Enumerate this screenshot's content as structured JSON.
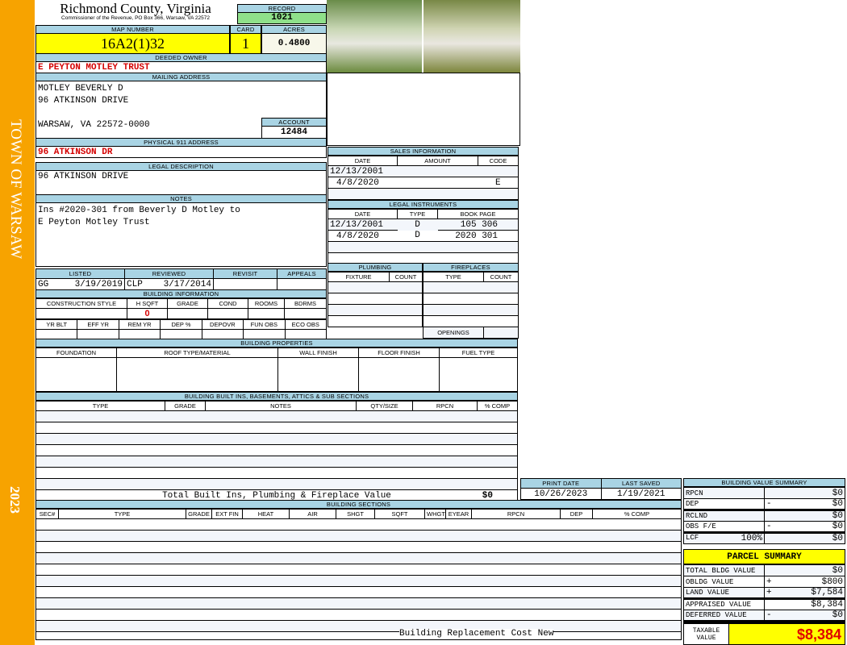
{
  "side": {
    "town": "TOWN OF WARSAW",
    "year": "2023"
  },
  "header": {
    "title": "Richmond County, Virginia",
    "subtitle": "Commissioner of the Revenue, PO Box 366, Warsaw, VA 22572",
    "record_label": "RECORD",
    "record": "1021"
  },
  "map": {
    "map_label": "MAP NUMBER",
    "map_number": "16A2(1)32",
    "card_label": "CARD",
    "card": "1",
    "acres_label": "ACRES",
    "acres": "0.4800"
  },
  "owner": {
    "label": "DEEDED OWNER",
    "value": "E PEYTON MOTLEY TRUST"
  },
  "mailing": {
    "label": "MAILING ADDRESS",
    "lines": [
      "MOTLEY BEVERLY D",
      "96 ATKINSON DRIVE",
      "",
      "WARSAW, VA 22572-0000"
    ],
    "account_label": "ACCOUNT",
    "account": "12484"
  },
  "physical": {
    "label": "PHYSICAL 911 ADDRESS",
    "value": "96 ATKINSON DR"
  },
  "legal": {
    "label": "LEGAL DESCRIPTION",
    "value": "96 ATKINSON DRIVE"
  },
  "notes": {
    "label": "NOTES",
    "lines": [
      "Ins #2020-301 from Beverly D Motley to",
      "E Peyton Motley Trust"
    ]
  },
  "review": {
    "headers": [
      "LISTED",
      "REVIEWED",
      "REVISIT",
      "APPEALS"
    ],
    "listed_by": "GG",
    "listed_date": "3/19/2019",
    "reviewed_by": "CLP",
    "reviewed_date": "3/17/2014"
  },
  "building_info": {
    "label": "BUILDING INFORMATION",
    "row1": [
      "CONSTRUCTION STYLE",
      "H SQFT",
      "GRADE",
      "COND",
      "ROOMS",
      "BDRMS"
    ],
    "hsqft": "0",
    "row2": [
      "YR BLT",
      "EFF YR",
      "REM YR",
      "DEP %",
      "DEPOVR",
      "FUN OBS",
      "ECO OBS"
    ]
  },
  "sales": {
    "label": "SALES INFORMATION",
    "headers": [
      "DATE",
      "AMOUNT",
      "CODE"
    ],
    "rows": [
      [
        "12/13/2001",
        "",
        ""
      ],
      [
        "4/8/2020",
        "",
        "E"
      ]
    ]
  },
  "instruments": {
    "label": "LEGAL INSTRUMENTS",
    "headers": [
      "DATE",
      "TYPE",
      "BOOK PAGE"
    ],
    "rows": [
      [
        "12/13/2001",
        "D",
        "105 306"
      ],
      [
        "4/8/2020",
        "D",
        "2020 301"
      ]
    ]
  },
  "plumbing": {
    "label": "PLUMBING",
    "headers": [
      "FIXTURE",
      "COUNT"
    ]
  },
  "fireplaces": {
    "label": "FIREPLACES",
    "headers": [
      "TYPE",
      "COUNT"
    ],
    "openings": "OPENINGS"
  },
  "properties": {
    "label": "BUILDING PROPERTIES",
    "headers": [
      "FOUNDATION",
      "ROOF TYPE/MATERIAL",
      "WALL FINISH",
      "FLOOR FINISH",
      "FUEL TYPE"
    ]
  },
  "builtins": {
    "label": "BUILDING BUILT INS, BASEMENTS, ATTICS & SUB SECTIONS",
    "headers": [
      "TYPE",
      "GRADE",
      "NOTES",
      "QTY/SIZE",
      "RPCN",
      "% COMP"
    ],
    "total_label": "Total Built Ins, Plumbing & Fireplace Value",
    "total": "$0"
  },
  "dates": {
    "print_label": "PRINT DATE",
    "print": "10/26/2023",
    "saved_label": "LAST SAVED",
    "saved": "1/19/2021"
  },
  "sections": {
    "label": "BUILDING SECTIONS",
    "headers": [
      "SEC#",
      "TYPE",
      "GRADE",
      "EXT FIN",
      "HEAT",
      "AIR",
      "SHGT",
      "SQFT",
      "WHGT",
      "EYEAR",
      "RPCN",
      "DEP",
      "% COMP"
    ],
    "footer": "Building Replacement Cost New"
  },
  "value_summary": {
    "label": "BUILDING VALUE SUMMARY",
    "rows": [
      {
        "name": "RPCN",
        "sign": "",
        "value": "$0"
      },
      {
        "name": "DEP",
        "sign": "-",
        "value": "$0"
      },
      {
        "name": "RCLND",
        "sign": "",
        "value": "$0"
      },
      {
        "name": "OBS F/E",
        "sign": "-",
        "value": "$0"
      },
      {
        "name": "LCF",
        "pct": "100%",
        "sign": "",
        "value": "$0"
      }
    ]
  },
  "parcel": {
    "label": "PARCEL SUMMARY",
    "rows": [
      {
        "name": "TOTAL BLDG VALUE",
        "sign": "",
        "value": "$0"
      },
      {
        "name": "OBLDG VALUE",
        "sign": "+",
        "value": "$800"
      },
      {
        "name": "LAND VALUE",
        "sign": "+",
        "value": "$7,584"
      },
      {
        "name": "APPRAISED VALUE",
        "sign": "",
        "value": "$8,384"
      },
      {
        "name": "DEFERRED VALUE",
        "sign": "-",
        "value": "$0"
      }
    ],
    "taxable_label": "TAXABLE VALUE",
    "taxable": "$8,384"
  }
}
